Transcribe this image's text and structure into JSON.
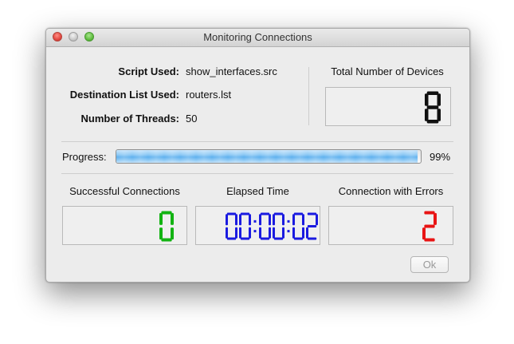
{
  "window": {
    "title": "Monitoring Connections"
  },
  "info": {
    "script_label": "Script Used:",
    "script_value": "show_interfaces.src",
    "dest_label": "Destination List Used:",
    "dest_value": "routers.lst",
    "threads_label": "Number of Threads:",
    "threads_value": "50"
  },
  "total_devices": {
    "label": "Total Number of Devices",
    "value": "8",
    "color": "#111111"
  },
  "progress": {
    "label": "Progress:",
    "percent": 99,
    "percent_text": "99%"
  },
  "successful": {
    "label": "Successful Connections",
    "value": "0",
    "color": "#12b312"
  },
  "elapsed": {
    "label": "Elapsed Time",
    "value": "00:00:02",
    "color": "#1a1ae0"
  },
  "errors": {
    "label": "Connection with Errors",
    "value": "2",
    "color": "#e81414"
  },
  "ok_button": {
    "label": "Ok"
  }
}
